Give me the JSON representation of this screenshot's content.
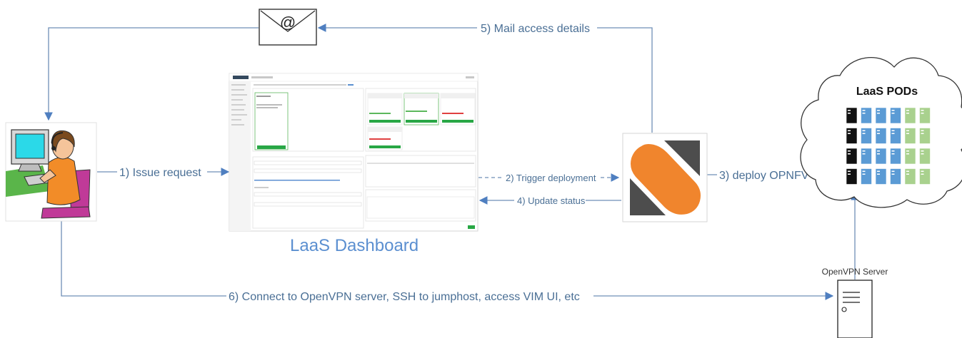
{
  "labels": {
    "mail_access": "5) Mail access details",
    "issue_request": "1) Issue request",
    "trigger_deployment": "2) Trigger deployment",
    "update_status": "4) Update status",
    "deploy_opnfv": "3) deploy OPNFV",
    "connect": "6) Connect to OpenVPN server, SSH to jumphost, access VIM UI, etc",
    "dashboard_caption": "LaaS Dashboard",
    "cloud_title": "LaaS PODs",
    "openvpn_server": "OpenVPN Server",
    "mail_symbol": "@"
  },
  "colors": {
    "edge": "#6f8fb6",
    "arrowhead": "#4f7fc0",
    "caption": "#5b8fd0",
    "server_black": "#111111",
    "server_blue": "#5b9bd5",
    "server_green": "#a9d18e",
    "logo_orange": "#f0852d",
    "logo_gray": "#4d4d4d"
  },
  "icons": {
    "mail": "envelope-icon",
    "user": "user-at-computer-icon",
    "dashboard": "dashboard-screenshot",
    "controller": "laas-logo",
    "cloud": "cloud-icon",
    "server": "server-icon"
  }
}
